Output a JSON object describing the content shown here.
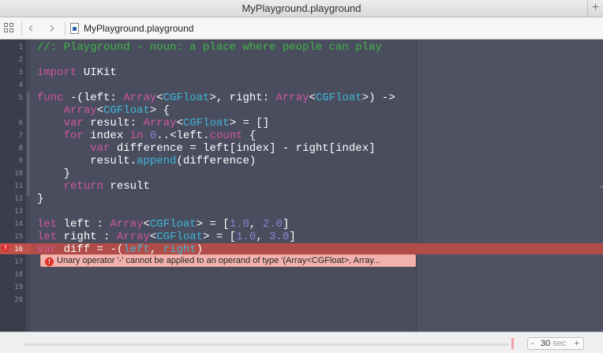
{
  "window": {
    "title": "MyPlayground.playground"
  },
  "jumpbar": {
    "file_name": "MyPlayground.playground"
  },
  "lines": [
    {
      "num": "1",
      "tokens": [
        {
          "t": "//: Playground - noun: a place where people can play",
          "c": "comment"
        }
      ]
    },
    {
      "num": "2",
      "tokens": []
    },
    {
      "num": "3",
      "tokens": [
        {
          "t": "import",
          "c": "kw"
        },
        {
          "t": " UIKit",
          "c": "plain"
        }
      ]
    },
    {
      "num": "4",
      "tokens": []
    },
    {
      "num": "5",
      "tokens": [
        {
          "t": "func",
          "c": "kw"
        },
        {
          "t": " -(left: ",
          "c": "plain"
        },
        {
          "t": "Array",
          "c": "kw"
        },
        {
          "t": "<",
          "c": "plain"
        },
        {
          "t": "CGFloat",
          "c": "type"
        },
        {
          "t": ">, right: ",
          "c": "plain"
        },
        {
          "t": "Array",
          "c": "kw"
        },
        {
          "t": "<",
          "c": "plain"
        },
        {
          "t": "CGFloat",
          "c": "type"
        },
        {
          "t": ">) ->",
          "c": "plain"
        }
      ]
    },
    {
      "num": "",
      "tokens": [
        {
          "t": "    ",
          "c": "plain"
        },
        {
          "t": "Array",
          "c": "kw"
        },
        {
          "t": "<",
          "c": "plain"
        },
        {
          "t": "CGFloat",
          "c": "type"
        },
        {
          "t": "> {",
          "c": "plain"
        }
      ]
    },
    {
      "num": "6",
      "tokens": [
        {
          "t": "    ",
          "c": "plain"
        },
        {
          "t": "var",
          "c": "kw"
        },
        {
          "t": " result: ",
          "c": "plain"
        },
        {
          "t": "Array",
          "c": "kw"
        },
        {
          "t": "<",
          "c": "plain"
        },
        {
          "t": "CGFloat",
          "c": "type"
        },
        {
          "t": "> = []",
          "c": "plain"
        }
      ]
    },
    {
      "num": "7",
      "tokens": [
        {
          "t": "    ",
          "c": "plain"
        },
        {
          "t": "for",
          "c": "kw"
        },
        {
          "t": " index ",
          "c": "plain"
        },
        {
          "t": "in",
          "c": "kw"
        },
        {
          "t": " ",
          "c": "plain"
        },
        {
          "t": "0",
          "c": "num"
        },
        {
          "t": "..<left.",
          "c": "plain"
        },
        {
          "t": "count",
          "c": "kw"
        },
        {
          "t": " {",
          "c": "plain"
        }
      ]
    },
    {
      "num": "8",
      "tokens": [
        {
          "t": "        ",
          "c": "plain"
        },
        {
          "t": "var",
          "c": "kw"
        },
        {
          "t": " difference = left[index] - right[index]",
          "c": "plain"
        }
      ]
    },
    {
      "num": "9",
      "tokens": [
        {
          "t": "        result.",
          "c": "plain"
        },
        {
          "t": "append",
          "c": "type"
        },
        {
          "t": "(difference)",
          "c": "plain"
        }
      ]
    },
    {
      "num": "10",
      "tokens": [
        {
          "t": "    }",
          "c": "plain"
        }
      ]
    },
    {
      "num": "11",
      "tokens": [
        {
          "t": "    ",
          "c": "plain"
        },
        {
          "t": "return",
          "c": "kw"
        },
        {
          "t": " result",
          "c": "plain"
        }
      ]
    },
    {
      "num": "12",
      "tokens": [
        {
          "t": "}",
          "c": "plain"
        }
      ]
    },
    {
      "num": "13",
      "tokens": []
    },
    {
      "num": "14",
      "tokens": [
        {
          "t": "let",
          "c": "kw"
        },
        {
          "t": " left : ",
          "c": "plain"
        },
        {
          "t": "Array",
          "c": "kw"
        },
        {
          "t": "<",
          "c": "plain"
        },
        {
          "t": "CGFloat",
          "c": "type"
        },
        {
          "t": "> = [",
          "c": "plain"
        },
        {
          "t": "1.0",
          "c": "num"
        },
        {
          "t": ", ",
          "c": "plain"
        },
        {
          "t": "2.0",
          "c": "num"
        },
        {
          "t": "]",
          "c": "plain"
        }
      ]
    },
    {
      "num": "15",
      "tokens": [
        {
          "t": "let",
          "c": "kw"
        },
        {
          "t": " right : ",
          "c": "plain"
        },
        {
          "t": "Array",
          "c": "kw"
        },
        {
          "t": "<",
          "c": "plain"
        },
        {
          "t": "CGFloat",
          "c": "type"
        },
        {
          "t": "> = [",
          "c": "plain"
        },
        {
          "t": "1.0",
          "c": "num"
        },
        {
          "t": ", ",
          "c": "plain"
        },
        {
          "t": "3.0",
          "c": "num"
        },
        {
          "t": "]",
          "c": "plain"
        }
      ]
    },
    {
      "num": "16",
      "tokens": [
        {
          "t": "var",
          "c": "kw"
        },
        {
          "t": " diff = -(",
          "c": "plain"
        },
        {
          "t": "left",
          "c": "type"
        },
        {
          "t": ", ",
          "c": "plain"
        },
        {
          "t": "right",
          "c": "type"
        },
        {
          "t": ")",
          "c": "plain"
        }
      ]
    },
    {
      "num": "17",
      "tokens": []
    },
    {
      "num": "18",
      "tokens": []
    },
    {
      "num": "19",
      "tokens": []
    },
    {
      "num": "20",
      "tokens": []
    }
  ],
  "error": {
    "line": "16",
    "badge": "!",
    "message": "Unary operator '-' cannot be applied to an operand of type '(Array<CGFloat>, Array..."
  },
  "timeline": {
    "minus": "-",
    "value": "30",
    "unit": "sec",
    "plus": "+"
  },
  "colors": {
    "comment": "#41b645",
    "keyword": "#d0579d",
    "type": "#3fb6d8",
    "number": "#8b84d0",
    "error_line": "#b04d48"
  }
}
